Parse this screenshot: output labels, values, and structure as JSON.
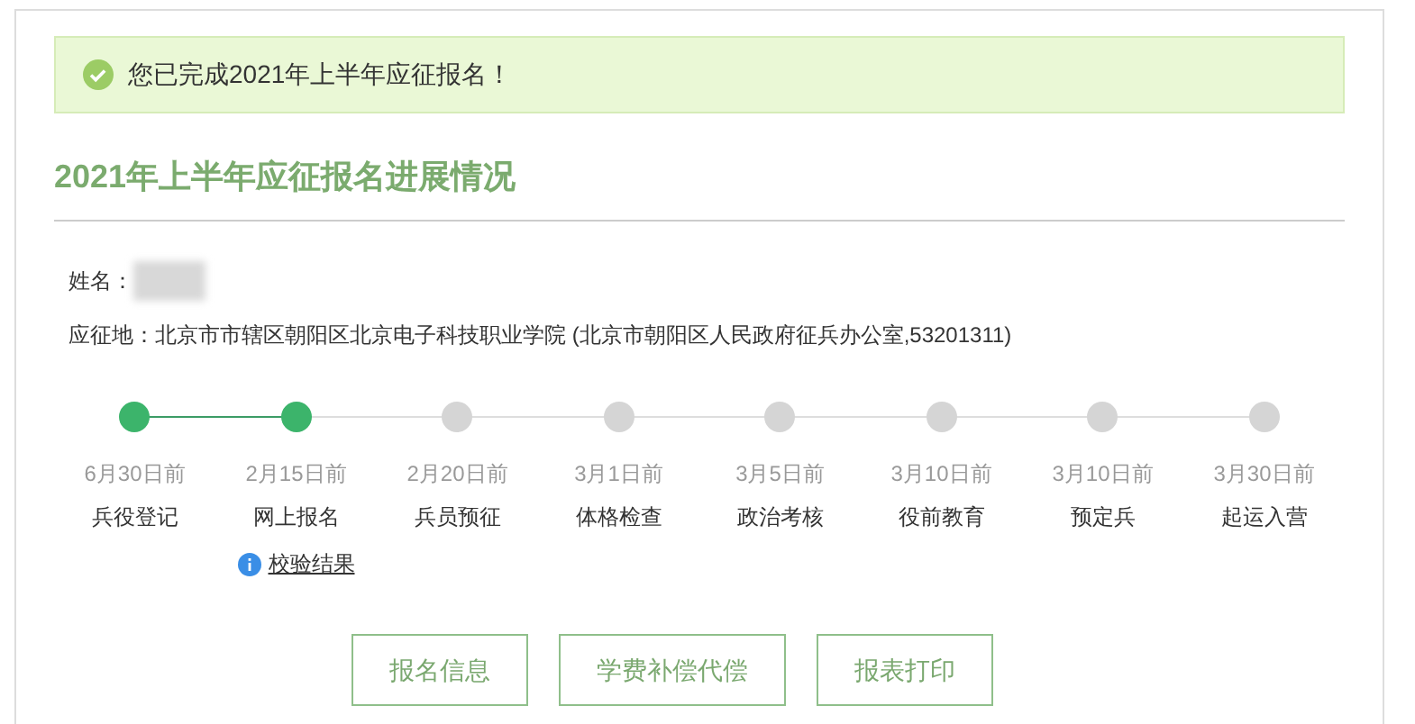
{
  "notice": {
    "text": "您已完成2021年上半年应征报名！"
  },
  "title": "2021年上半年应征报名进展情况",
  "info": [
    {
      "label": "姓名：",
      "redacted": true
    },
    {
      "label": "应征地：",
      "value": "北京市市辖区朝阳区北京电子科技职业学院 (北京市朝阳区人民政府征兵办公室,53201311)",
      "redacted": false
    }
  ],
  "steps": [
    {
      "date": "6月30日前",
      "label": "兵役登记",
      "done": true
    },
    {
      "date": "2月15日前",
      "label": "网上报名",
      "done": true,
      "link": "校验结果"
    },
    {
      "date": "2月20日前",
      "label": "兵员预征",
      "done": false
    },
    {
      "date": "3月1日前",
      "label": "体格检查",
      "done": false
    },
    {
      "date": "3月5日前",
      "label": "政治考核",
      "done": false
    },
    {
      "date": "3月10日前",
      "label": "役前教育",
      "done": false
    },
    {
      "date": "3月10日前",
      "label": "预定兵",
      "done": false
    },
    {
      "date": "3月30日前",
      "label": "起运入营",
      "done": false
    }
  ],
  "buttons": [
    "报名信息",
    "学费补偿代偿",
    "报表打印"
  ]
}
